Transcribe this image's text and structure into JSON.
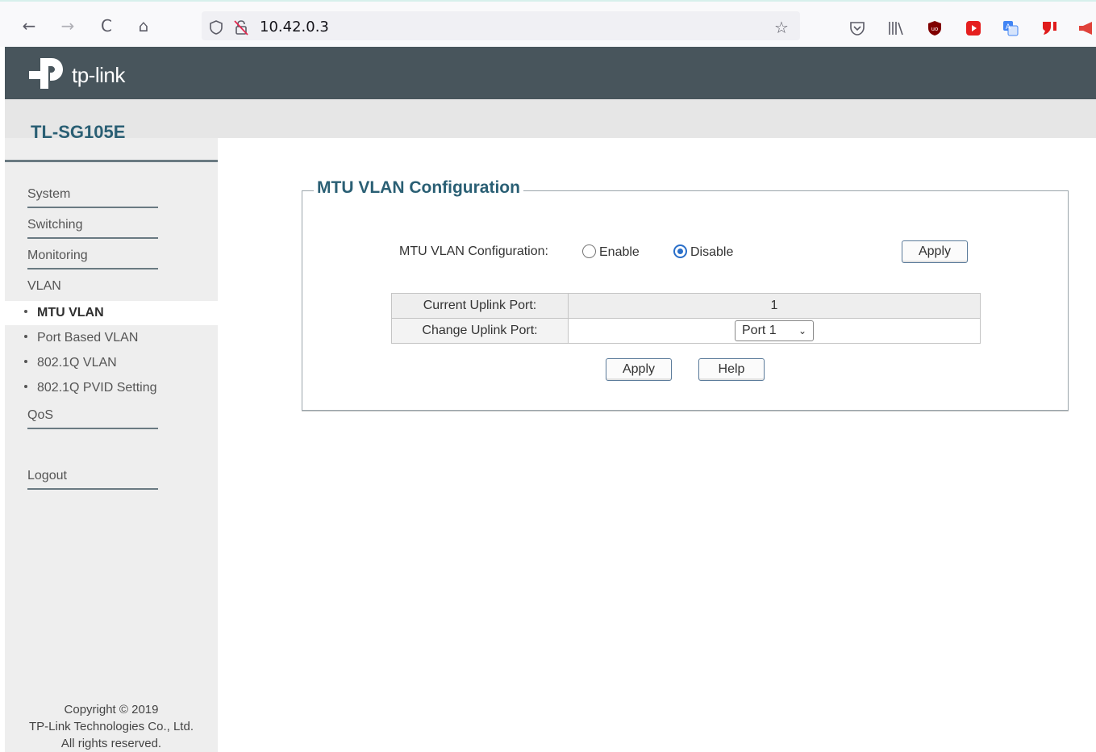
{
  "browser": {
    "url": "10.42.0.3",
    "back_icon": "←",
    "forward_icon": "→",
    "reload_icon": "C",
    "home_icon": "⌂",
    "star_icon": "☆"
  },
  "header": {
    "brand": "tp-link",
    "model": "TL-SG105E"
  },
  "sidebar": {
    "items": [
      {
        "label": "System"
      },
      {
        "label": "Switching"
      },
      {
        "label": "Monitoring"
      }
    ],
    "vlan_label": "VLAN",
    "vlan_sub": [
      {
        "label": "MTU VLAN",
        "active": true
      },
      {
        "label": "Port Based VLAN"
      },
      {
        "label": "802.1Q VLAN"
      },
      {
        "label": "802.1Q PVID Setting"
      }
    ],
    "qos_label": "QoS",
    "logout_label": "Logout",
    "copyright": {
      "line1": "Copyright © 2019",
      "line2": "TP-Link Technologies Co., Ltd.",
      "line3": "All rights reserved."
    }
  },
  "content": {
    "legend": "MTU VLAN Configuration",
    "config_label": "MTU VLAN Configuration:",
    "enable_label": "Enable",
    "disable_label": "Disable",
    "selected_mode": "Disable",
    "apply_top": "Apply",
    "table": {
      "current_label": "Current Uplink Port:",
      "current_value": "1",
      "change_label": "Change Uplink Port:",
      "change_value": "Port 1"
    },
    "apply_bottom": "Apply",
    "help": "Help"
  },
  "colors": {
    "header_bg": "#48555c",
    "accent": "#2a5f74",
    "radio_checked": "#2a6fc9"
  }
}
